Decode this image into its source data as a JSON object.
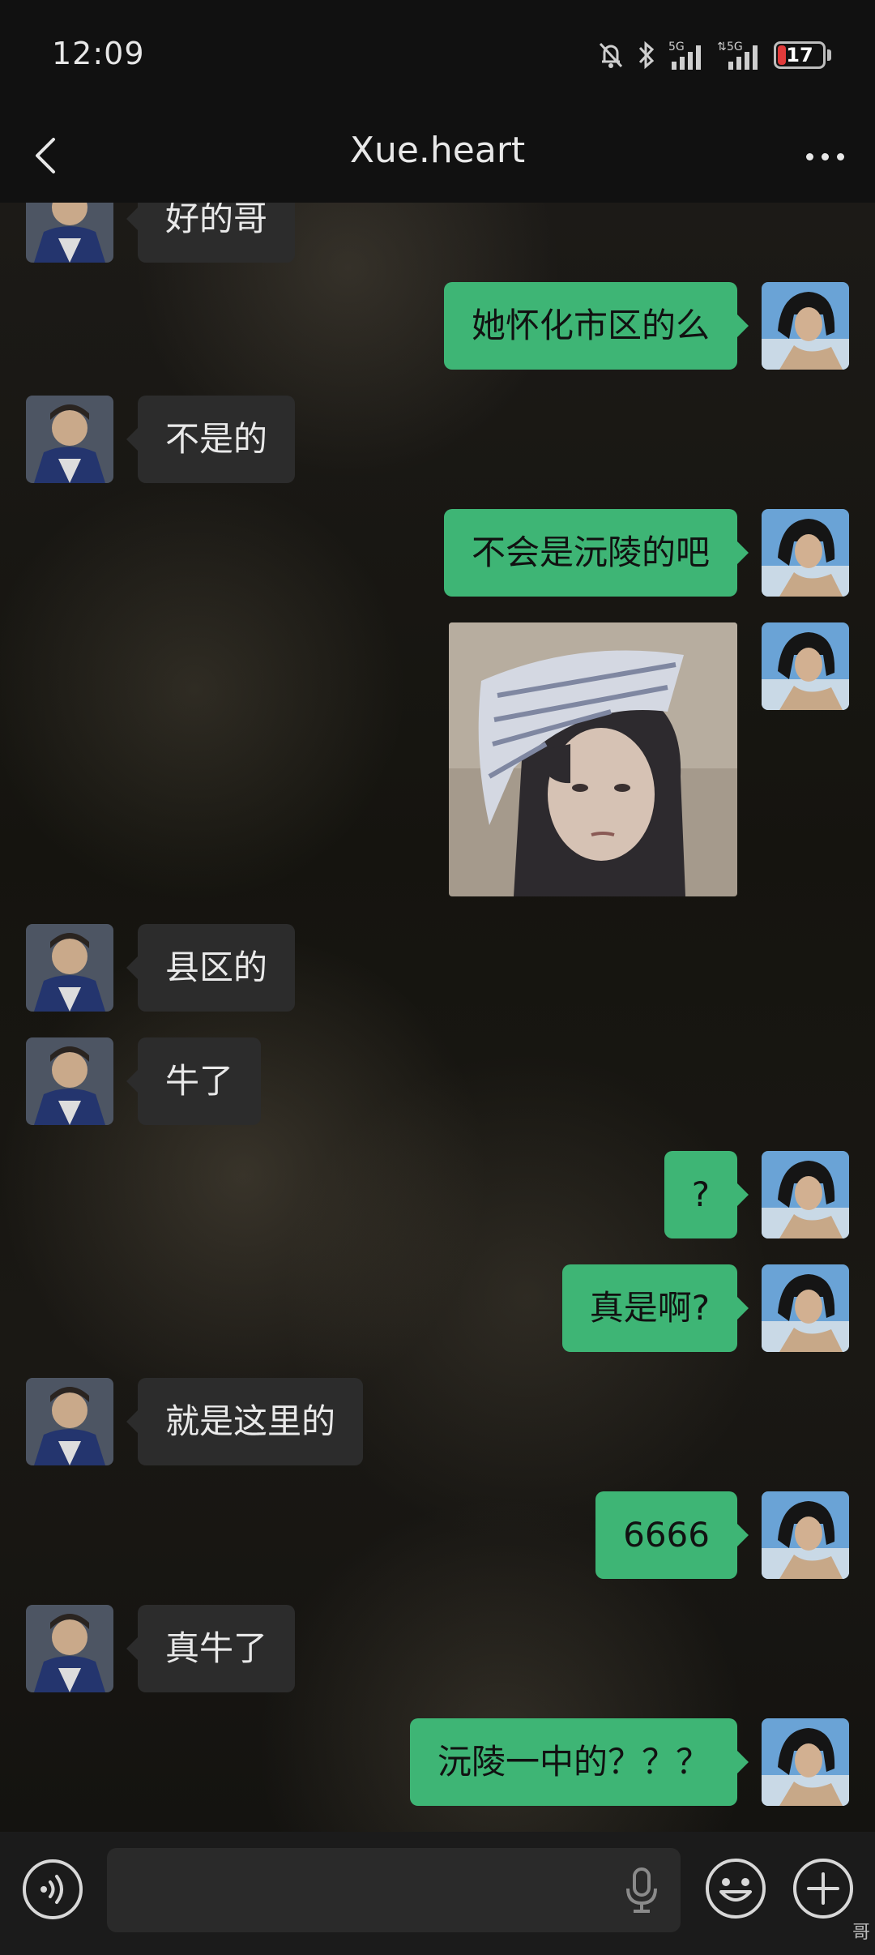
{
  "status_bar": {
    "time": "12:09",
    "battery": "17",
    "signal_1": "5G",
    "signal_2": "5G"
  },
  "header": {
    "title": "Xue.heart",
    "back_icon": "chevron-left-icon",
    "more_icon": "more-dots-icon"
  },
  "messages": [
    {
      "side": "left",
      "text": "好的哥"
    },
    {
      "side": "right",
      "text": "她怀化市区的么"
    },
    {
      "side": "left",
      "text": "不是的"
    },
    {
      "side": "right",
      "text": "不会是沅陵的吧"
    },
    {
      "side": "right",
      "type": "sticker",
      "content": "sticker-image"
    },
    {
      "side": "left",
      "text": "县区的"
    },
    {
      "side": "left",
      "text": "牛了"
    },
    {
      "side": "right",
      "text": "?"
    },
    {
      "side": "right",
      "text": "真是啊?"
    },
    {
      "side": "left",
      "text": "就是这里的"
    },
    {
      "side": "right",
      "text": "6666"
    },
    {
      "side": "left",
      "text": "真牛了"
    },
    {
      "side": "right",
      "text": "沅陵一中的？？？"
    }
  ],
  "input_bar": {
    "voice_icon": "voice-mode-icon",
    "input_value": "",
    "mic_icon": "microphone-icon",
    "emoji_icon": "emoji-icon",
    "plus_icon": "plus-icon"
  },
  "watermark": "哥",
  "colors": {
    "sent_bubble": "#3eb575",
    "received_bubble": "#2c2c2c",
    "bar_background": "#111111"
  }
}
